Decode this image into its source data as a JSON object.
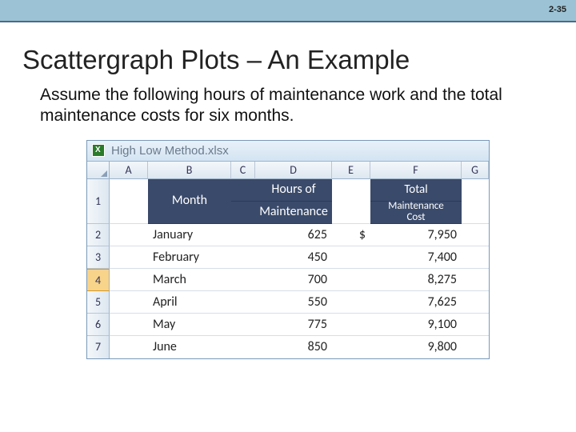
{
  "page_number": "2-35",
  "title": "Scattergraph Plots – An Example",
  "subtitle": "Assume the following hours of maintenance work and the total maintenance costs for six months.",
  "excel": {
    "filename": "High Low Method.xlsx",
    "columns": [
      "A",
      "B",
      "C",
      "D",
      "E",
      "F",
      "G"
    ],
    "row_numbers": [
      "1",
      "2",
      "3",
      "4",
      "5",
      "6",
      "7"
    ],
    "selected_row": "4",
    "headers": {
      "month": "Month",
      "hours_top": "Hours of",
      "hours_bottom": "Maintenance",
      "total_top": "Total",
      "total_mid": "Maintenance",
      "total_bot": "Cost"
    },
    "currency": "$",
    "rows": [
      {
        "month": "January",
        "hours": "625",
        "cost": "7,950"
      },
      {
        "month": "February",
        "hours": "450",
        "cost": "7,400"
      },
      {
        "month": "March",
        "hours": "700",
        "cost": "8,275"
      },
      {
        "month": "April",
        "hours": "550",
        "cost": "7,625"
      },
      {
        "month": "May",
        "hours": "775",
        "cost": "9,100"
      },
      {
        "month": "June",
        "hours": "850",
        "cost": "9,800"
      }
    ]
  },
  "chart_data": {
    "type": "table",
    "title": "Hours of Maintenance vs Total Maintenance Cost",
    "columns": [
      "Month",
      "Hours of Maintenance",
      "Total Maintenance Cost ($)"
    ],
    "rows": [
      [
        "January",
        625,
        7950
      ],
      [
        "February",
        450,
        7400
      ],
      [
        "March",
        700,
        8275
      ],
      [
        "April",
        550,
        7625
      ],
      [
        "May",
        775,
        9100
      ],
      [
        "June",
        850,
        9800
      ]
    ]
  }
}
